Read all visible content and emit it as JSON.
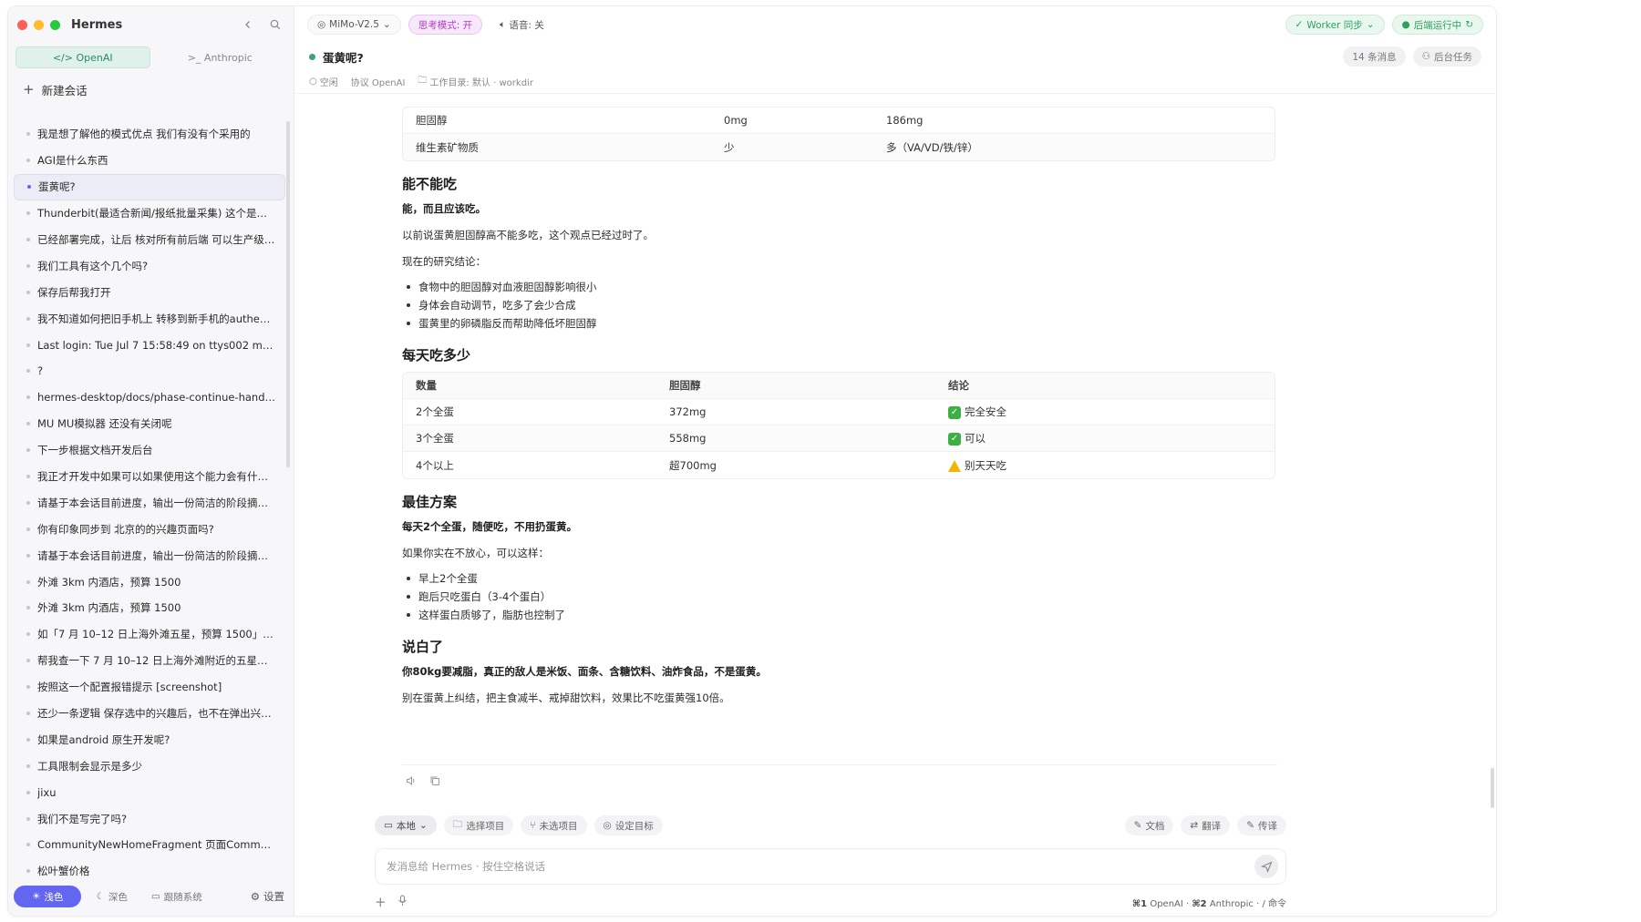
{
  "app": {
    "title": "Hermes"
  },
  "sidebar": {
    "protocols": [
      {
        "label": "</> OpenAI",
        "active": true
      },
      {
        "label": ">_ Anthropic",
        "active": false
      }
    ],
    "new_chat_label": "新建会话",
    "conversations": [
      "我是想了解他的模式优点 我们有没有个采用的",
      "AGI是什么东西",
      "蛋黄呢?",
      "Thunderbit(最适合新闻/报纸批量采集) 这个是什么...",
      "已经部署完成，让后 核对所有前后端 可以生产级交...",
      "我们工具有这个几个吗?",
      "保存后帮我打开",
      "我不知道如何把旧手机上 转移到新手机的authenti...",
      "Last login: Tue Jul 7 15:58:49 on ttys002 ma...",
      "?",
      "hermes-desktop/docs/phase-continue-handoff...",
      "MU MU模拟器 还没有关闭呢",
      "下一步根据文档开发后台",
      "我正才开发中如果可以如果使用这个能力会有什么...",
      "请基于本会话目前进度，输出一份简洁的阶段摘要...",
      "你有印象同步到 北京的的兴趣页面吗?",
      "请基于本会话目前进度，输出一份简洁的阶段摘要...",
      "外滩 3km 内酒店，预算 1500",
      "外滩 3km 内酒店，预算 1500",
      "如「7 月 10–12 日上海外滩五星，预算 1500」在...",
      "帮我查一下 7 月 10–12 日上海外滩附近的五星酒店...",
      "按照这一个配置报错提示 [screenshot]",
      "还少一条逻辑 保存选中的兴趣后，也不在弹出兴趣...",
      "如果是android 原生开发呢?",
      "工具限制会显示是多少",
      "jixu",
      "我们不是写完了吗?",
      "CommunityNewHomeFragment 页面Communit...",
      "松叶蟹价格"
    ],
    "active_index": 2,
    "footer": {
      "light": "浅色",
      "dark": "深色",
      "system": "跟随系统",
      "settings": "设置"
    }
  },
  "topbar": {
    "model": "MiMo-V2.5",
    "thinking": "思考模式: 开",
    "voice": "语音: 关",
    "worker": "Worker 同步",
    "backend": "后端运行中"
  },
  "conversation": {
    "title": "蛋黄呢?",
    "message_count": "14 条消息",
    "bg_tasks": "后台任务",
    "meta": {
      "status": "空闲",
      "protocol": "协议 OpenAI",
      "workdir": "工作目录: 默认 · workdir"
    }
  },
  "message": {
    "table1": [
      [
        "胆固醇",
        "0mg",
        "186mg"
      ],
      [
        "维生素矿物质",
        "少",
        "多（VA/VD/铁/锌）"
      ]
    ],
    "h_can_eat": "能不能吃",
    "p_can_eat_bold": "能，而且应该吃。",
    "p_old_view": "以前说蛋黄胆固醇高不能多吃，这个观点已经过时了。",
    "p_research": "现在的研究结论：",
    "list_research": [
      "食物中的胆固醇对血液胆固醇影响很小",
      "身体会自动调节，吃多了会少合成",
      "蛋黄里的卵磷脂反而帮助降低坏胆固醇"
    ],
    "h_daily": "每天吃多少",
    "table2_head": [
      "数量",
      "胆固醇",
      "结论"
    ],
    "table2": [
      [
        "2个全蛋",
        "372mg",
        "完全安全",
        "ok"
      ],
      [
        "3个全蛋",
        "558mg",
        "可以",
        "ok"
      ],
      [
        "4个以上",
        "超700mg",
        "别天天吃",
        "warn"
      ]
    ],
    "h_best": "最佳方案",
    "p_best_bold": "每天2个全蛋，随便吃，不用扔蛋黄。",
    "p_if_worry": "如果你实在不放心，可以这样：",
    "list_best": [
      "早上2个全蛋",
      "跑后只吃蛋白（3-4个蛋白）",
      "这样蛋白质够了，脂肪也控制了"
    ],
    "h_summary": "说白了",
    "p_summary_bold": "你80kg要减脂，真正的敌人是米饭、面条、含糖饮料、油炸食品，不是蛋黄。",
    "p_summary": "别在蛋黄上纠结，把主食减半、戒掉甜饮料，效果比不吃蛋黄强10倍。"
  },
  "toolbar": {
    "local": "本地",
    "select_project": "选择项目",
    "no_project": "未选项目",
    "set_goal": "设定目标",
    "doc": "文档",
    "translate": "翻译",
    "transcribe": "传译"
  },
  "composer": {
    "placeholder": "发消息给 Hermes · 按住空格说话",
    "hint_1_key": "⌘1",
    "hint_1": "OpenAI",
    "hint_2_key": "⌘2",
    "hint_2": "Anthropic",
    "hint_3": "/ 命令"
  }
}
